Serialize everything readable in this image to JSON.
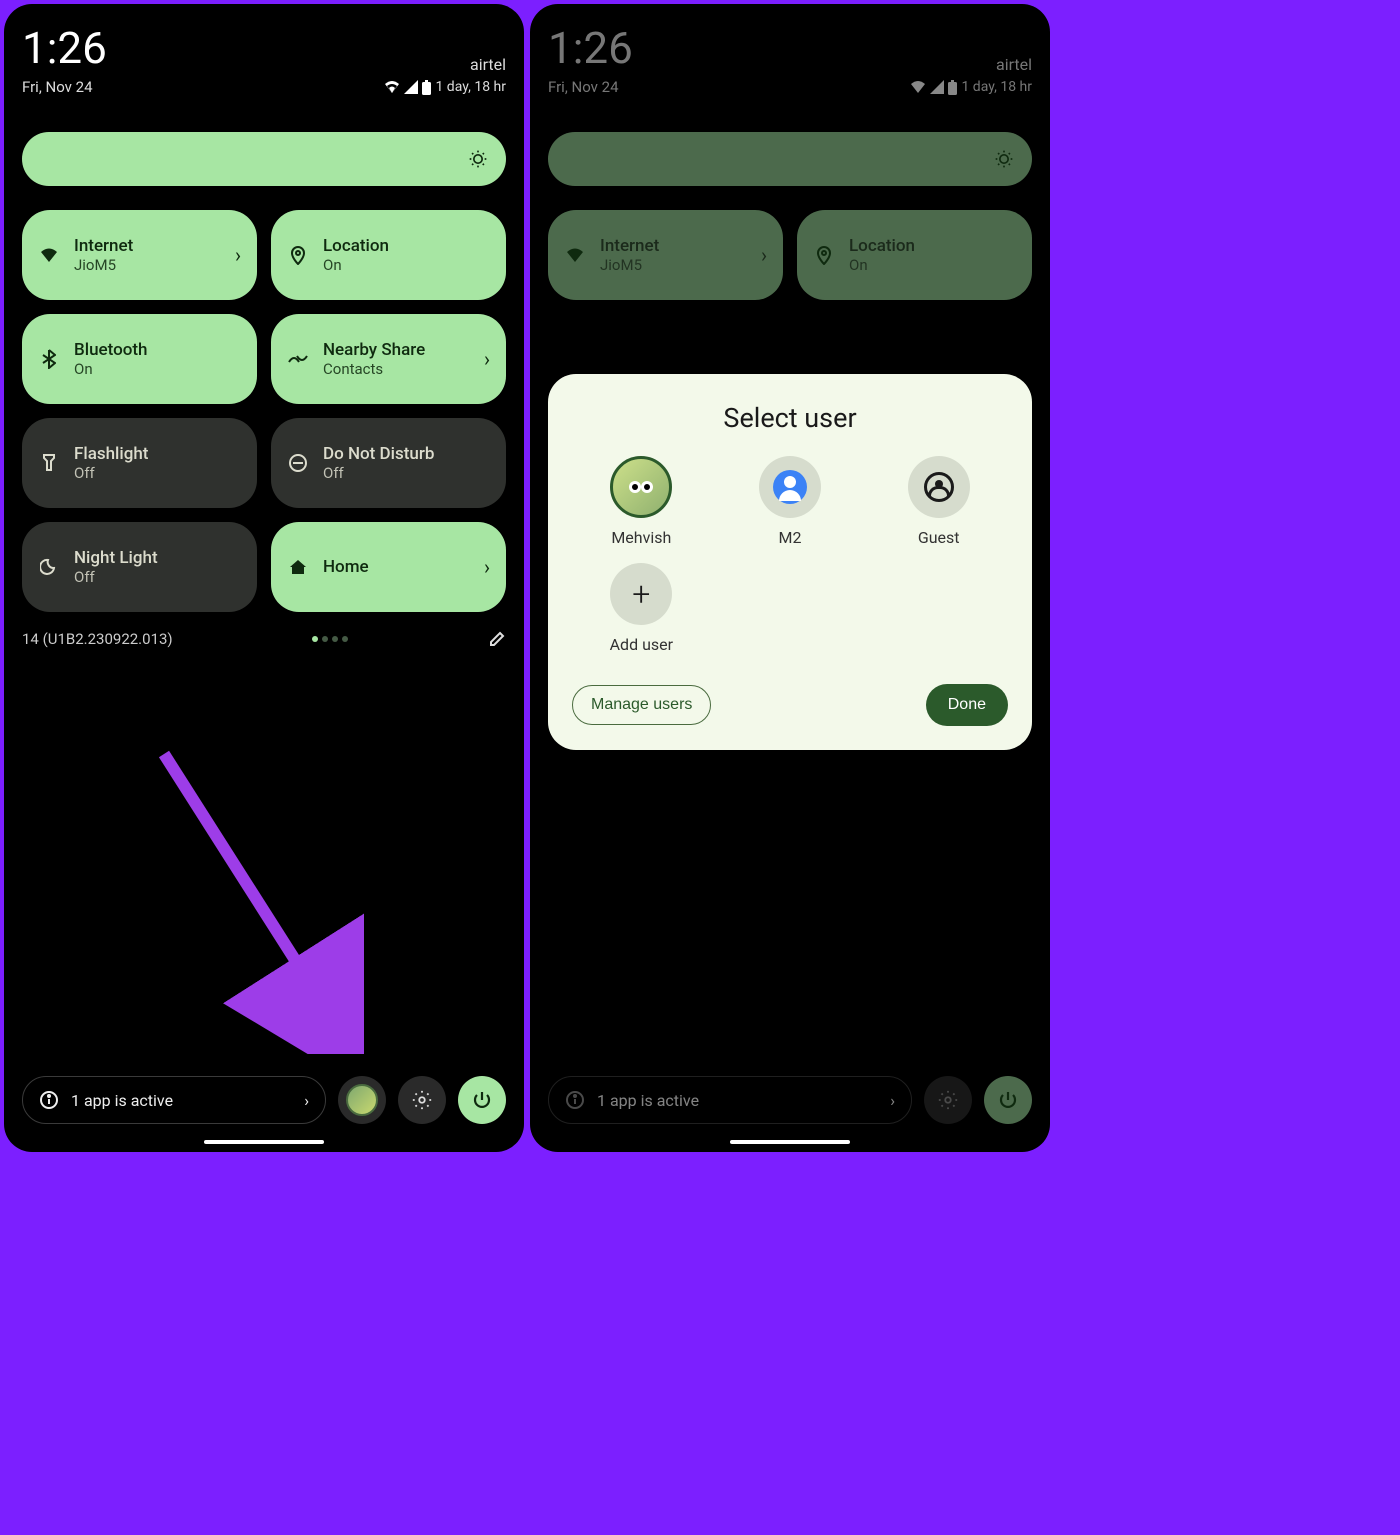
{
  "status": {
    "time": "1:26",
    "date": "Fri, Nov 24",
    "carrier": "airtel",
    "battery_text": "1 day, 18 hr"
  },
  "tiles": {
    "internet": {
      "label": "Internet",
      "sub": "JioM5"
    },
    "location": {
      "label": "Location",
      "sub": "On"
    },
    "bluetooth": {
      "label": "Bluetooth",
      "sub": "On"
    },
    "nearby": {
      "label": "Nearby Share",
      "sub": "Contacts"
    },
    "flashlight": {
      "label": "Flashlight",
      "sub": "Off"
    },
    "dnd": {
      "label": "Do Not Disturb",
      "sub": "Off"
    },
    "nightlight": {
      "label": "Night Light",
      "sub": "Off"
    },
    "home": {
      "label": "Home",
      "sub": ""
    }
  },
  "build": "14 (U1B2.230922.013)",
  "active_apps": "1 app is active",
  "user_dialog": {
    "title": "Select user",
    "users": [
      "Mehvish",
      "M2",
      "Guest"
    ],
    "add_user": "Add user",
    "manage": "Manage users",
    "done": "Done"
  }
}
